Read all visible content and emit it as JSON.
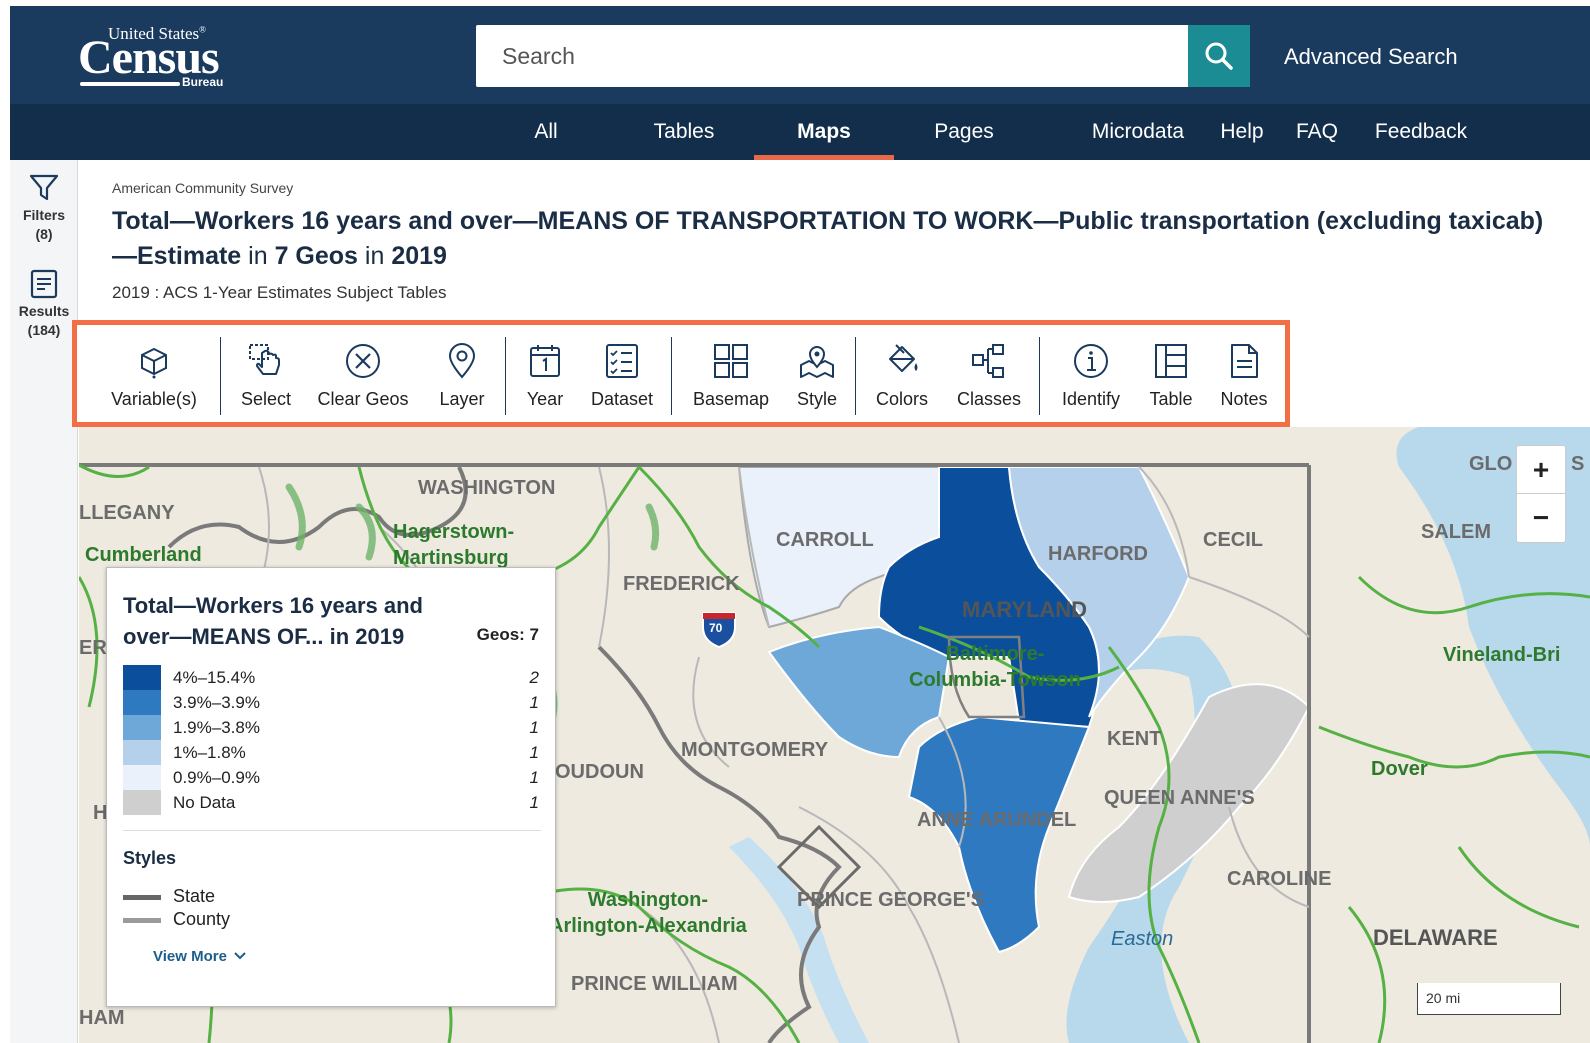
{
  "header": {
    "logo": {
      "line1": "United States",
      "registered": "®",
      "line2": "Census",
      "line3": "Bureau"
    },
    "search_placeholder": "Search",
    "advanced_search": "Advanced Search"
  },
  "nav": {
    "items": [
      {
        "label": "All",
        "active": false
      },
      {
        "label": "Tables",
        "active": false
      },
      {
        "label": "Maps",
        "active": true
      },
      {
        "label": "Pages",
        "active": false
      },
      {
        "label": "Microdata",
        "active": false
      },
      {
        "label": "Help",
        "active": false
      },
      {
        "label": "FAQ",
        "active": false
      },
      {
        "label": "Feedback",
        "active": false
      }
    ]
  },
  "rail": {
    "filters": {
      "label": "Filters",
      "count": "(8)",
      "icon": "filter-icon"
    },
    "results": {
      "label": "Results",
      "count": "(184)",
      "icon": "results-list-icon"
    }
  },
  "page": {
    "survey": "American Community Survey",
    "title_main": "Total—Workers 16 years and over—MEANS OF TRANSPORTATION TO WORK—Public transportation (excluding taxicab)—Estimate",
    "title_in1": " in ",
    "title_geos": "7 Geos",
    "title_in2": " in ",
    "title_year": "2019",
    "subtitle": "2019 : ACS 1-Year Estimates Subject Tables"
  },
  "toolbar": {
    "highlight_color": "#f26f45",
    "tools": [
      {
        "label": "Variable(s)",
        "icon": "cube-icon"
      },
      {
        "label": "Select",
        "icon": "select-hand-icon"
      },
      {
        "label": "Clear Geos",
        "icon": "clear-circle-x-icon"
      },
      {
        "label": "Layer",
        "icon": "map-pin-icon"
      },
      {
        "label": "Year",
        "icon": "calendar-icon"
      },
      {
        "label": "Dataset",
        "icon": "checklist-icon"
      },
      {
        "label": "Basemap",
        "icon": "grid-icon"
      },
      {
        "label": "Style",
        "icon": "map-style-icon"
      },
      {
        "label": "Colors",
        "icon": "paint-bucket-icon"
      },
      {
        "label": "Classes",
        "icon": "classes-tree-icon"
      },
      {
        "label": "Identify",
        "icon": "info-icon"
      },
      {
        "label": "Table",
        "icon": "table-icon"
      },
      {
        "label": "Notes",
        "icon": "notes-icon"
      }
    ]
  },
  "map": {
    "labels": {
      "washington": "WASHINGTON",
      "allegany": "LLEGANY",
      "cumberland": "Cumberland",
      "hagerstown": "Hagerstown-\nMartinsburg",
      "carroll": "CARROLL",
      "harford": "HARFORD",
      "cecil": "CECIL",
      "salem": "SALEM",
      "glo": "GLO",
      "s_edge": "S",
      "frederick": "FREDERICK",
      "interstate": "70",
      "maryland": "MARYLAND",
      "baltimore": "Baltimore-\nColumbia-Towson",
      "vineland": "Vineland-Bri",
      "montgomery": "MONTGOMERY",
      "loudoun": "OUDOUN",
      "kent": "KENT",
      "queen_annes": "QUEEN ANNE'S",
      "dover": "Dover",
      "anne_arundel": "ANNE ARUNDEL",
      "washington_dc": "Washington-\nArlington-Alexandria",
      "prince_georges": "PRINCE GEORGE'S",
      "caroline": "CAROLINE",
      "easton": "Easton",
      "delaware": "DELAWARE",
      "prince_william": "PRINCE WILLIAM",
      "er_edge": "ER",
      "h_edge": "H",
      "ham_edge": "HAM"
    },
    "zoom_in": "+",
    "zoom_out": "−",
    "scale": "20 mi"
  },
  "legend": {
    "title": "Total—Workers 16 years and over—MEANS OF... in 2019",
    "geos": "Geos: 7",
    "classes": [
      {
        "label": "4%–15.4%",
        "count": "2",
        "color": "#0b4f9c"
      },
      {
        "label": "3.9%–3.9%",
        "count": "1",
        "color": "#2f79c0"
      },
      {
        "label": "1.9%–3.8%",
        "count": "1",
        "color": "#6ea8d8"
      },
      {
        "label": "1%–1.8%",
        "count": "1",
        "color": "#b5d0ea"
      },
      {
        "label": "0.9%–0.9%",
        "count": "1",
        "color": "#eaf1fa"
      },
      {
        "label": "No Data",
        "count": "1",
        "color": "#cfcfcf"
      }
    ],
    "styles_heading": "Styles",
    "styles": [
      {
        "label": "State",
        "color": "#666666"
      },
      {
        "label": "County",
        "color": "#9a9a9a"
      }
    ],
    "view_more": "View More"
  },
  "colors": {
    "header_bg": "#1a3a5e",
    "nav_bg": "#132e4b",
    "search_btn": "#1b8c93",
    "nav_active_underline": "#e8684a"
  }
}
